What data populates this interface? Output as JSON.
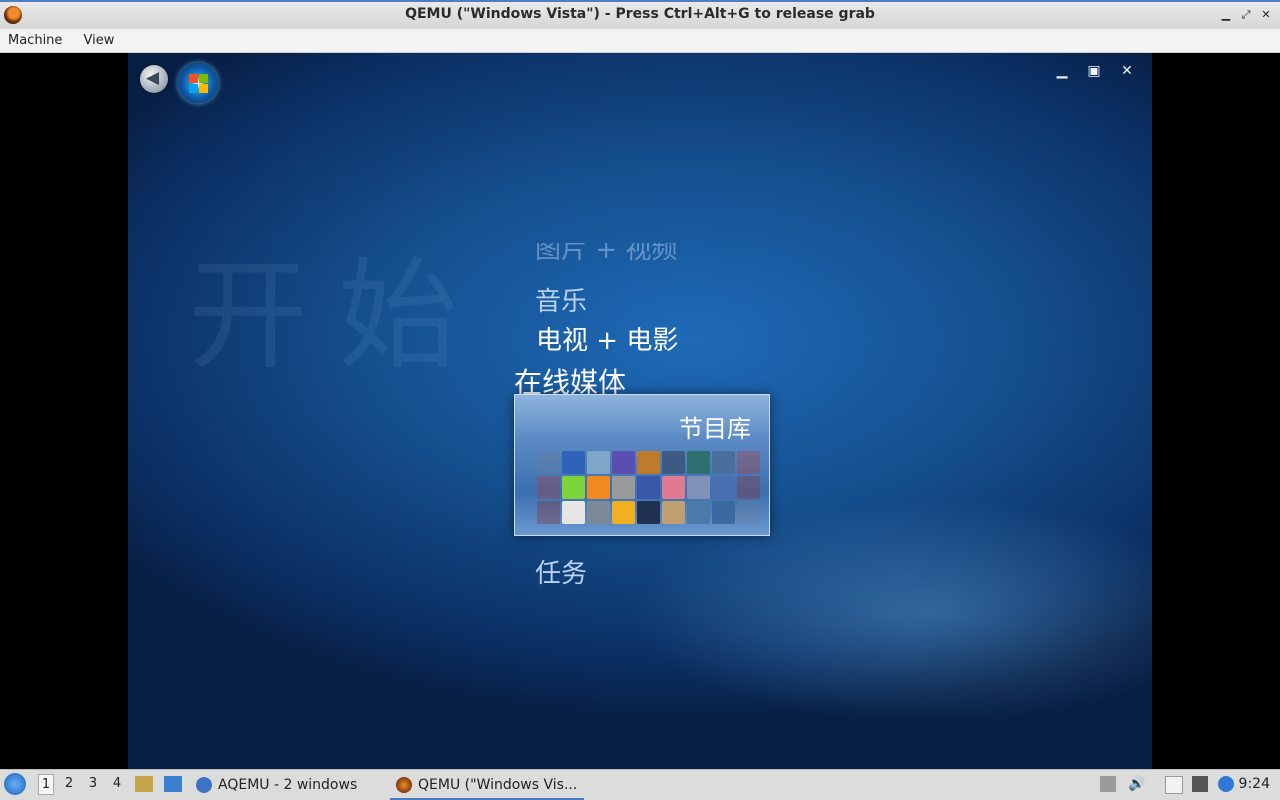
{
  "window": {
    "title": "QEMU (\"Windows Vista\") - Press Ctrl+Alt+G to release grab",
    "min_glyph": "▁",
    "max_glyph": "⤢",
    "close_glyph": "✕"
  },
  "menubar": {
    "items": [
      "Machine",
      "View"
    ]
  },
  "media_center": {
    "ghost_text": "开始",
    "back_glyph": "◀",
    "controls": {
      "minimize": "▁",
      "restore": "▣",
      "close": "✕"
    },
    "menu": {
      "partial_item": "图片 + 视频",
      "music": "音乐",
      "tv_movies": "电视 + 电影",
      "online_media": "在线媒体",
      "tasks": "任务"
    },
    "panel": {
      "title": "节目库"
    }
  },
  "taskbar": {
    "workspaces": [
      "1",
      "2",
      "3",
      "4"
    ],
    "tasks": [
      {
        "label": "AQEMU - 2 windows"
      },
      {
        "label": "QEMU (\"Windows Vis..."
      }
    ],
    "clock": "9:24"
  },
  "colors": {
    "accent": "#4a7fc1",
    "mc_bg": "#15508f"
  }
}
